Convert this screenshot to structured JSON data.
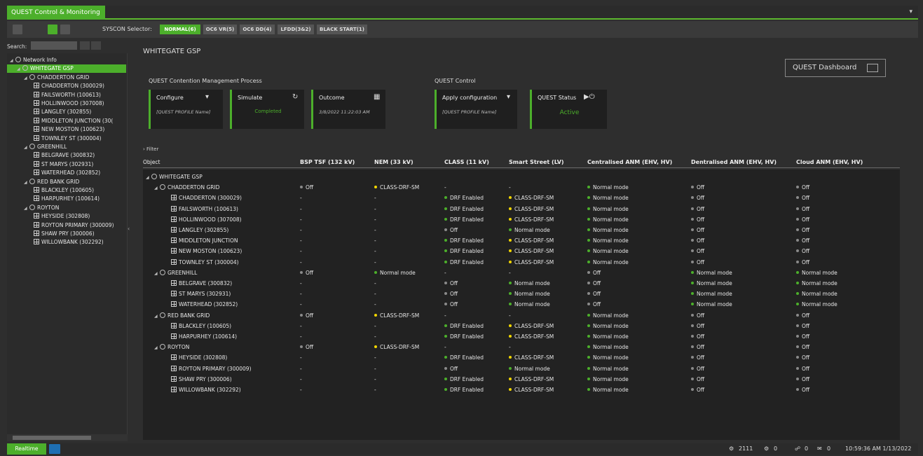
{
  "app": {
    "title": "QUEST Control & Monitoring",
    "menu_glyph": "▾"
  },
  "toolbar": {
    "syscon_label": "SYSCON Selector:",
    "syscon_options": [
      "NORMAL(6)",
      "OC6 VR(5)",
      "OC6 DD(4)",
      "LFDD(3&2)",
      "BLACK START(1)"
    ],
    "active_option": "NORMAL(6)"
  },
  "search": {
    "label": "Search:",
    "value": ""
  },
  "tree": [
    {
      "label": "Network Info",
      "depth": 0,
      "icon": "network-info-icon",
      "expanded": true
    },
    {
      "label": "WHITEGATE GSP",
      "depth": 1,
      "icon": "substation-icon",
      "expanded": true,
      "selected": true
    },
    {
      "label": "CHADDERTON GRID",
      "depth": 2,
      "icon": "substation-icon",
      "expanded": true
    },
    {
      "label": "CHADDERTON (300029)",
      "depth": 3,
      "icon": "grid-icon"
    },
    {
      "label": "FAILSWORTH (100613)",
      "depth": 3,
      "icon": "grid-icon"
    },
    {
      "label": "HOLLINWOOD (307008)",
      "depth": 3,
      "icon": "grid-icon"
    },
    {
      "label": "LANGLEY (302855)",
      "depth": 3,
      "icon": "grid-icon"
    },
    {
      "label": "MIDDLETON JUNCTION (30(",
      "depth": 3,
      "icon": "grid-icon"
    },
    {
      "label": "NEW MOSTON (100623)",
      "depth": 3,
      "icon": "grid-icon"
    },
    {
      "label": "TOWNLEY ST (300004)",
      "depth": 3,
      "icon": "grid-icon"
    },
    {
      "label": "GREENHILL",
      "depth": 2,
      "icon": "substation-icon",
      "expanded": true
    },
    {
      "label": "BELGRAVE (300832)",
      "depth": 3,
      "icon": "grid-icon"
    },
    {
      "label": "ST MARYS (302931)",
      "depth": 3,
      "icon": "grid-icon"
    },
    {
      "label": "WATERHEAD (302852)",
      "depth": 3,
      "icon": "grid-icon"
    },
    {
      "label": "RED BANK GRID",
      "depth": 2,
      "icon": "substation-icon",
      "expanded": true
    },
    {
      "label": "BLACKLEY (100605)",
      "depth": 3,
      "icon": "grid-icon"
    },
    {
      "label": "HARPURHEY (100614)",
      "depth": 3,
      "icon": "grid-icon"
    },
    {
      "label": "ROYTON",
      "depth": 2,
      "icon": "substation-icon",
      "expanded": true
    },
    {
      "label": "HEYSIDE (302808)",
      "depth": 3,
      "icon": "grid-icon"
    },
    {
      "label": "ROYTON PRIMARY (300009)",
      "depth": 3,
      "icon": "grid-icon"
    },
    {
      "label": "SHAW PRY (300006)",
      "depth": 3,
      "icon": "grid-icon"
    },
    {
      "label": "WILLOWBANK (302292)",
      "depth": 3,
      "icon": "grid-icon"
    }
  ],
  "main": {
    "gsp_title": "WHITEGATE GSP",
    "dashboard_button": "QUEST Dashboard",
    "contention_title": "QUEST Contention Management Process",
    "control_title": "QUEST Control",
    "cards": [
      {
        "id": "configure",
        "title": "Configure",
        "sub": "[QUEST PROFILE Name]",
        "status": ""
      },
      {
        "id": "simulate",
        "title": "Simulate",
        "sub": "",
        "status": "Completed"
      },
      {
        "id": "outcome",
        "title": "Outcome",
        "sub": "3/8/2022 11:22:03 AM",
        "status": ""
      },
      {
        "id": "apply",
        "title": "Apply configuration",
        "sub": "[QUEST PROFILE Name]",
        "status": ""
      },
      {
        "id": "status",
        "title": "QUEST Status",
        "sub": "",
        "status": "Active"
      }
    ],
    "filter_label": "Filter",
    "columns": [
      "Object",
      "BSP TSF (132 kV)",
      "NEM (33 kV)",
      "CLASS (11 kV)",
      "Smart Street (LV)",
      "Centralised ANM (EHV, HV)",
      "Dentralised ANM (EHV, HV)",
      "Cloud ANM (EHV, HV)"
    ],
    "rows": [
      {
        "obj": "WHITEGATE GSP",
        "depth": 0,
        "type": "sub",
        "cells": [
          "",
          "",
          "",
          "",
          "",
          "",
          ""
        ]
      },
      {
        "obj": "CHADDERTON GRID",
        "depth": 1,
        "type": "sub",
        "cells": [
          "Off",
          "CLASS-DRF-SM",
          "-",
          "-",
          "Normal mode",
          "Off",
          "Off"
        ]
      },
      {
        "obj": "CHADDERTON (300029)",
        "depth": 2,
        "type": "grid",
        "cells": [
          "-",
          "-",
          "DRF Enabled",
          "CLASS-DRF-SM",
          "Normal mode",
          "Off",
          "Off"
        ]
      },
      {
        "obj": "FAILSWORTH (100613)",
        "depth": 2,
        "type": "grid",
        "cells": [
          "-",
          "-",
          "DRF Enabled",
          "CLASS-DRF-SM",
          "Normal mode",
          "Off",
          "Off"
        ]
      },
      {
        "obj": "HOLLINWOOD (307008)",
        "depth": 2,
        "type": "grid",
        "cells": [
          "-",
          "-",
          "DRF Enabled",
          "CLASS-DRF-SM",
          "Normal mode",
          "Off",
          "Off"
        ]
      },
      {
        "obj": "LANGLEY (302855)",
        "depth": 2,
        "type": "grid",
        "cells": [
          "-",
          "-",
          "Off",
          "Normal mode",
          "Normal mode",
          "Off",
          "Off"
        ]
      },
      {
        "obj": "MIDDLETON JUNCTION",
        "depth": 2,
        "type": "grid",
        "cells": [
          "-",
          "-",
          "DRF Enabled",
          "CLASS-DRF-SM",
          "Normal mode",
          "Off",
          "Off"
        ]
      },
      {
        "obj": "NEW MOSTON (100623)",
        "depth": 2,
        "type": "grid",
        "cells": [
          "-",
          "-",
          "DRF Enabled",
          "CLASS-DRF-SM",
          "Normal mode",
          "Off",
          "Off"
        ]
      },
      {
        "obj": "TOWNLEY ST (300004)",
        "depth": 2,
        "type": "grid",
        "cells": [
          "-",
          "-",
          "DRF Enabled",
          "CLASS-DRF-SM",
          "Normal mode",
          "Off",
          "Off"
        ]
      },
      {
        "obj": "GREENHILL",
        "depth": 1,
        "type": "sub",
        "cells": [
          "Off",
          "Normal mode",
          "-",
          "-",
          "Off",
          "Normal mode",
          "Normal mode"
        ]
      },
      {
        "obj": "BELGRAVE (300832)",
        "depth": 2,
        "type": "grid",
        "cells": [
          "-",
          "-",
          "Off",
          "Normal mode",
          "Off",
          "Normal mode",
          "Normal mode"
        ]
      },
      {
        "obj": "ST MARYS (302931)",
        "depth": 2,
        "type": "grid",
        "cells": [
          "-",
          "-",
          "Off",
          "Normal mode",
          "Off",
          "Normal mode",
          "Normal mode"
        ]
      },
      {
        "obj": "WATERHEAD (302852)",
        "depth": 2,
        "type": "grid",
        "cells": [
          "-",
          "-",
          "Off",
          "Normal mode",
          "Off",
          "Normal mode",
          "Normal mode"
        ]
      },
      {
        "obj": "RED BANK GRID",
        "depth": 1,
        "type": "sub",
        "cells": [
          "Off",
          "CLASS-DRF-SM",
          "-",
          "-",
          "Normal mode",
          "Off",
          "Off"
        ]
      },
      {
        "obj": "BLACKLEY (100605)",
        "depth": 2,
        "type": "grid",
        "cells": [
          "-",
          "-",
          "DRF Enabled",
          "CLASS-DRF-SM",
          "Normal mode",
          "Off",
          "Off"
        ]
      },
      {
        "obj": "HARPURHEY (100614)",
        "depth": 2,
        "type": "grid",
        "cells": [
          "-",
          "-",
          "DRF Enabled",
          "CLASS-DRF-SM",
          "Normal mode",
          "Off",
          "Off"
        ]
      },
      {
        "obj": "ROYTON",
        "depth": 1,
        "type": "sub",
        "cells": [
          "Off",
          "CLASS-DRF-SM",
          "-",
          "-",
          "Normal mode",
          "Off",
          "Off"
        ]
      },
      {
        "obj": "HEYSIDE (302808)",
        "depth": 2,
        "type": "grid",
        "cells": [
          "-",
          "-",
          "DRF Enabled",
          "CLASS-DRF-SM",
          "Normal mode",
          "Off",
          "Off"
        ]
      },
      {
        "obj": "ROYTON PRIMARY (300009)",
        "depth": 2,
        "type": "grid",
        "cells": [
          "-",
          "-",
          "Off",
          "Normal mode",
          "Normal mode",
          "Off",
          "Off"
        ]
      },
      {
        "obj": "SHAW PRY (300006)",
        "depth": 2,
        "type": "grid",
        "cells": [
          "-",
          "-",
          "DRF Enabled",
          "CLASS-DRF-SM",
          "Normal mode",
          "Off",
          "Off"
        ]
      },
      {
        "obj": "WILLOWBANK (302292)",
        "depth": 2,
        "type": "grid",
        "cells": [
          "-",
          "-",
          "DRF Enabled",
          "CLASS-DRF-SM",
          "Normal mode",
          "Off",
          "Off"
        ]
      }
    ]
  },
  "status_colors": {
    "green": "#4caf2b",
    "yellow": "#f2d600",
    "grey": "#8a8a8a"
  },
  "statusbar": {
    "mode": "Realtime",
    "alarm_count": "2111",
    "count_a": "0",
    "count_b": "0",
    "count_c": "0",
    "datetime": "10:59:36 AM 1/13/2022"
  }
}
